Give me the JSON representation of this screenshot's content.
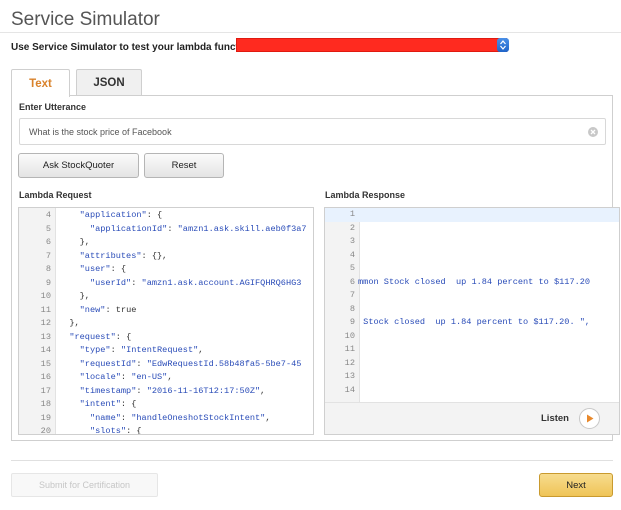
{
  "page": {
    "title": "Service Simulator",
    "function_label": "Use Service Simulator to test your lambda function:",
    "function_value": "",
    "redaction_color": "#ff2a1f"
  },
  "tabs": [
    {
      "label": "Text",
      "active": true
    },
    {
      "label": "JSON",
      "active": false
    }
  ],
  "utterance": {
    "label": "Enter Utterance",
    "value": "What is the stock price of Facebook"
  },
  "buttons": {
    "ask": "Ask StockQuoter",
    "reset": "Reset",
    "submit": "Submit for Certification",
    "next": "Next"
  },
  "lambda_request": {
    "label": "Lambda Request",
    "lines": [
      {
        "n": "4",
        "text": "    \"application\": {"
      },
      {
        "n": "5",
        "text": "      \"applicationId\": \"amzn1.ask.skill.aeb0f3a7"
      },
      {
        "n": "6",
        "text": "    },"
      },
      {
        "n": "7",
        "text": "    \"attributes\": {},"
      },
      {
        "n": "8",
        "text": "    \"user\": {"
      },
      {
        "n": "9",
        "text": "      \"userId\": \"amzn1.ask.account.AGIFQHRQ6HG3"
      },
      {
        "n": "10",
        "text": "    },"
      },
      {
        "n": "11",
        "text": "    \"new\": true"
      },
      {
        "n": "12",
        "text": "  },"
      },
      {
        "n": "13",
        "text": "  \"request\": {"
      },
      {
        "n": "14",
        "text": "    \"type\": \"IntentRequest\","
      },
      {
        "n": "15",
        "text": "    \"requestId\": \"EdwRequestId.58b48fa5-5be7-45"
      },
      {
        "n": "16",
        "text": "    \"locale\": \"en-US\","
      },
      {
        "n": "17",
        "text": "    \"timestamp\": \"2016-11-16T12:17:50Z\","
      },
      {
        "n": "18",
        "text": "    \"intent\": {"
      },
      {
        "n": "19",
        "text": "      \"name\": \"handleOneshotStockIntent\","
      },
      {
        "n": "20",
        "text": "      \"slots\": {"
      }
    ]
  },
  "lambda_response": {
    "label": "Lambda Response",
    "lines": [
      {
        "n": "1",
        "text": "",
        "active": true
      },
      {
        "n": "2",
        "text": ""
      },
      {
        "n": "3",
        "text": ""
      },
      {
        "n": "4",
        "text": ""
      },
      {
        "n": "5",
        "text": ""
      },
      {
        "n": "6",
        "text": "mmon Stock closed  up 1.84 percent to $117.20"
      },
      {
        "n": "7",
        "text": ""
      },
      {
        "n": "8",
        "text": ""
      },
      {
        "n": "9",
        "text": " Stock closed  up 1.84 percent to $117.20. \","
      },
      {
        "n": "10",
        "text": ""
      },
      {
        "n": "11",
        "text": ""
      },
      {
        "n": "12",
        "text": ""
      },
      {
        "n": "13",
        "text": ""
      },
      {
        "n": "14",
        "text": ""
      }
    ],
    "listen_label": "Listen"
  },
  "colors": {
    "active_tab": "#d9822b",
    "code_string": "#2a4cb8",
    "next_button": "#efc457",
    "play_icon": "#e8892c",
    "stepper": "#2f76d8"
  }
}
